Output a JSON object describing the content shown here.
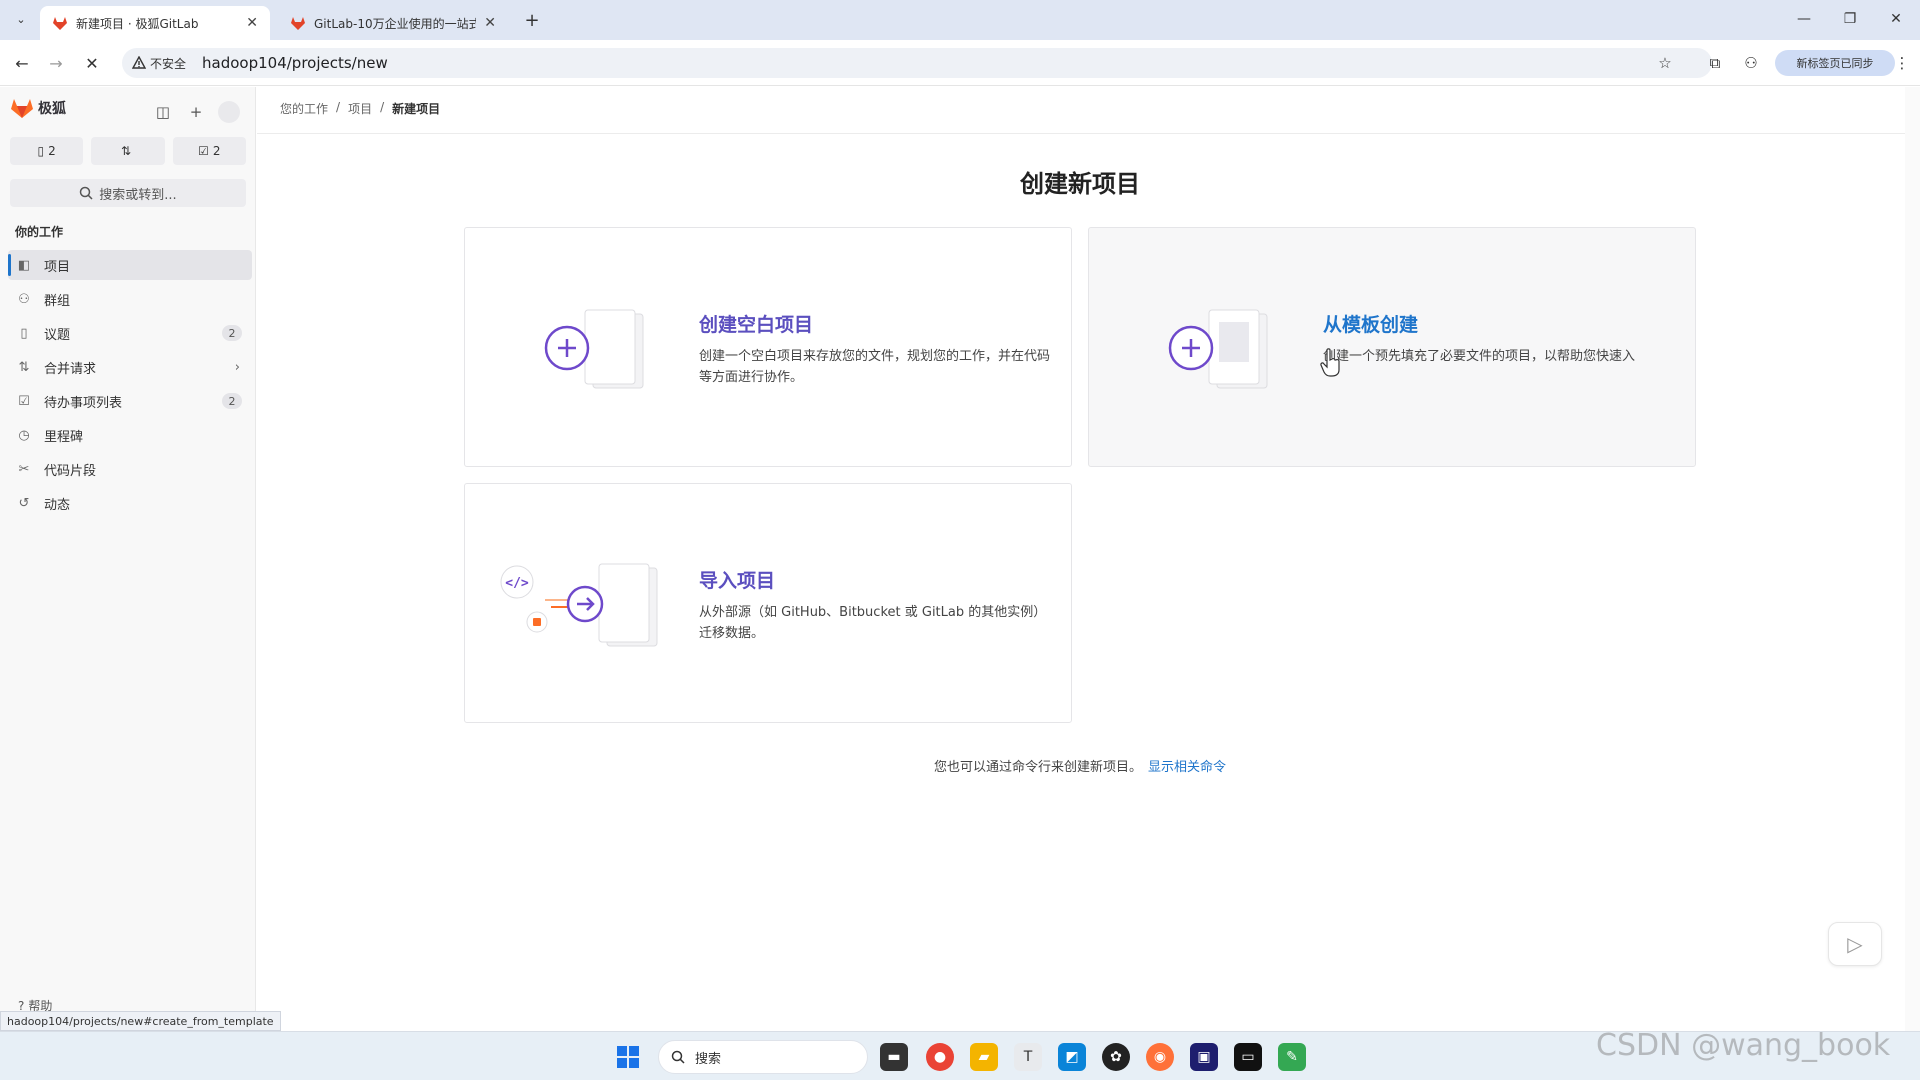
{
  "browser": {
    "tabs": [
      {
        "title": "新建项目 · 极狐GitLab",
        "close": "✕",
        "active": true
      },
      {
        "title": "GitLab-10万企业使用的一站式",
        "close": "✕",
        "active": false
      }
    ],
    "new_tab": "+",
    "window_controls": {
      "minimize": "—",
      "restore": "❐",
      "close": "✕"
    },
    "nav": {
      "back": "←",
      "forward": "→",
      "stop": "✕"
    },
    "security_label": "不安全",
    "url": "hadoop104/projects/new",
    "profile_label": "新标签页已同步"
  },
  "sidebar": {
    "brand": "极狐",
    "counters": [
      {
        "icon": "issue-icon",
        "count": "2"
      },
      {
        "icon": "merge-request-icon",
        "count": ""
      },
      {
        "icon": "todo-icon",
        "count": "2"
      }
    ],
    "search_label": "搜索或转到...",
    "section_title": "你的工作",
    "items": [
      {
        "label": "项目",
        "icon": "project-icon",
        "badge": "",
        "active": true
      },
      {
        "label": "群组",
        "icon": "group-icon",
        "badge": ""
      },
      {
        "label": "议题",
        "icon": "issue-icon",
        "badge": "2"
      },
      {
        "label": "合并请求",
        "icon": "merge-request-icon",
        "badge": "",
        "chevron": "›"
      },
      {
        "label": "待办事项列表",
        "icon": "todo-icon",
        "badge": "2"
      },
      {
        "label": "里程碑",
        "icon": "milestone-icon",
        "badge": ""
      },
      {
        "label": "代码片段",
        "icon": "snippet-icon",
        "badge": ""
      },
      {
        "label": "动态",
        "icon": "activity-icon",
        "badge": ""
      }
    ],
    "help_label": "帮助"
  },
  "breadcrumb": [
    "您的工作",
    "项目",
    "新建项目"
  ],
  "page_title": "创建新项目",
  "cards": {
    "blank": {
      "title": "创建空白项目",
      "description": "创建一个空白项目来存放您的文件，规划您的工作，并在代码等方面进行协作。"
    },
    "template": {
      "title": "从模板创建",
      "description": "创建一个预先填充了必要文件的项目，以帮助您快速入"
    },
    "import": {
      "title": "导入项目",
      "description": "从外部源（如 GitHub、Bitbucket 或 GitLab 的其他实例）迁移数据。"
    }
  },
  "footer": {
    "text": "您也可以通过命令行来创建新项目。",
    "link": "显示相关命令"
  },
  "status_url": "hadoop104/projects/new#create_from_template",
  "taskbar": {
    "search_label": "搜索"
  },
  "watermark": "CSDN @wang_book",
  "colors": {
    "accent": "#1f75cb",
    "purple": "#5b4fbf",
    "illustration": "#6e49cb"
  }
}
